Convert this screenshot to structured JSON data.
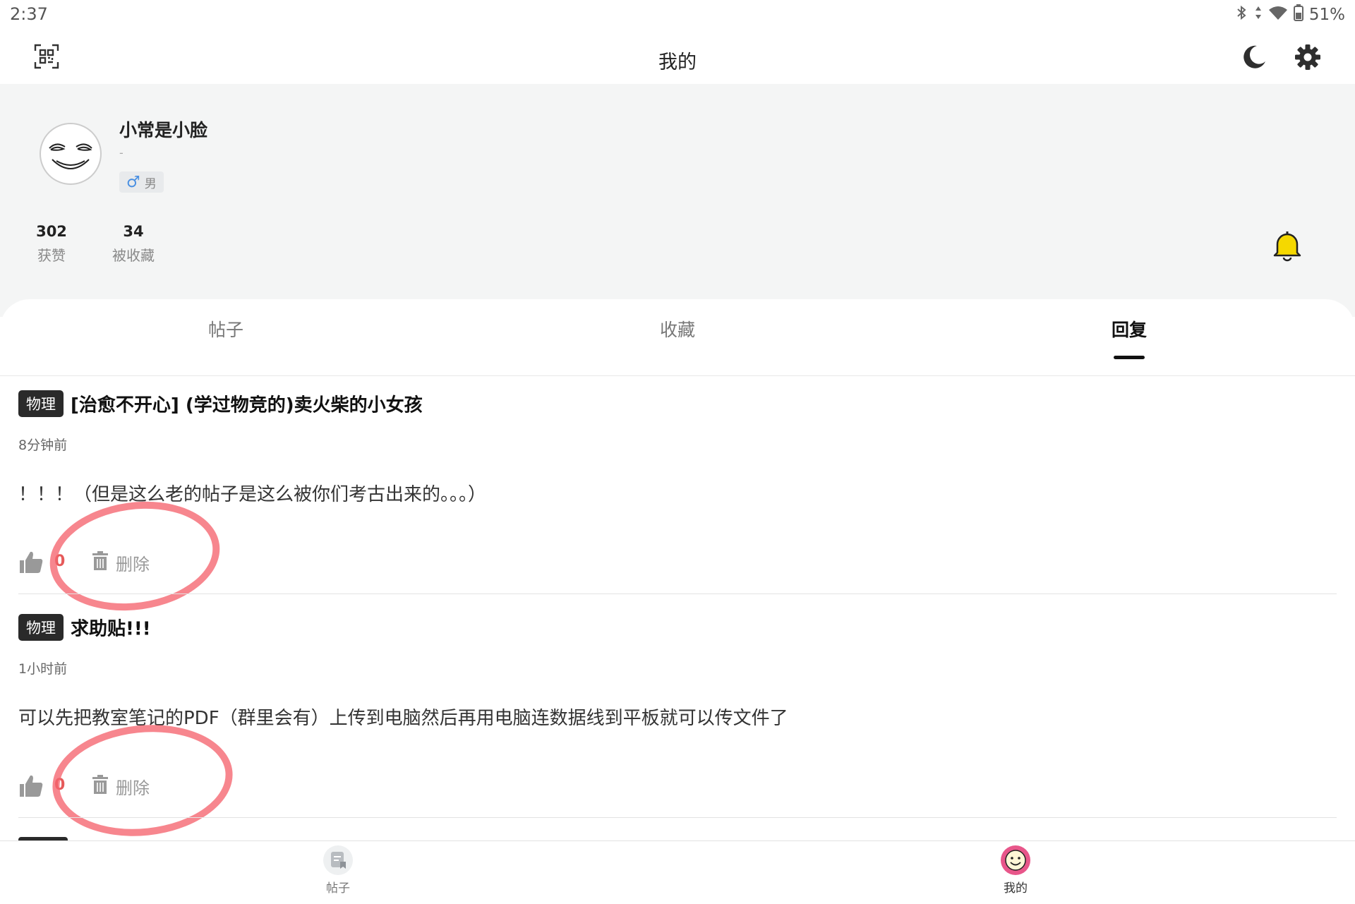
{
  "status_bar": {
    "time": "2:37",
    "battery": "51%"
  },
  "header": {
    "title": "我的"
  },
  "icons": {
    "qr_scan": "qr-scan-icon",
    "dark_mode": "moon-icon",
    "settings": "gear-icon",
    "notifications": "bell-icon",
    "like": "thumbs-up-icon",
    "delete": "trash-icon"
  },
  "profile": {
    "username": "小常是小脸",
    "signature": "-",
    "gender_symbol": "♂",
    "gender": "男",
    "stats": [
      {
        "value": "302",
        "label": "获赞"
      },
      {
        "value": "34",
        "label": "被收藏"
      }
    ]
  },
  "tabs": [
    {
      "label": "帖子",
      "active": false
    },
    {
      "label": "收藏",
      "active": false
    },
    {
      "label": "回复",
      "active": true
    }
  ],
  "replies": [
    {
      "tag": "物理",
      "post_title": "[治愈不开心] (学过物竞的)卖火柴的小女孩",
      "time": "8分钟前",
      "content": "！！！（但是这么老的帖子是这么被你们考古出来的。。。）",
      "likes": "0",
      "delete_label": "删除"
    },
    {
      "tag": "物理",
      "post_title": "求助贴!!!",
      "time": "1小时前",
      "content": "可以先把教室笔记的PDF（群里会有）上传到电脑然后再用电脑连数据线到平板就可以传文件了",
      "likes": "0",
      "delete_label": "删除"
    }
  ],
  "bottom_nav": [
    {
      "label": "帖子",
      "active": false
    },
    {
      "label": "我的",
      "active": true
    }
  ],
  "colors": {
    "accent_bell": "#f5d800",
    "like_count": "#e65a5a",
    "annotation": "#f5646e",
    "avatar_ring": "#e8568a",
    "tag_bg": "#2a2a2a"
  }
}
